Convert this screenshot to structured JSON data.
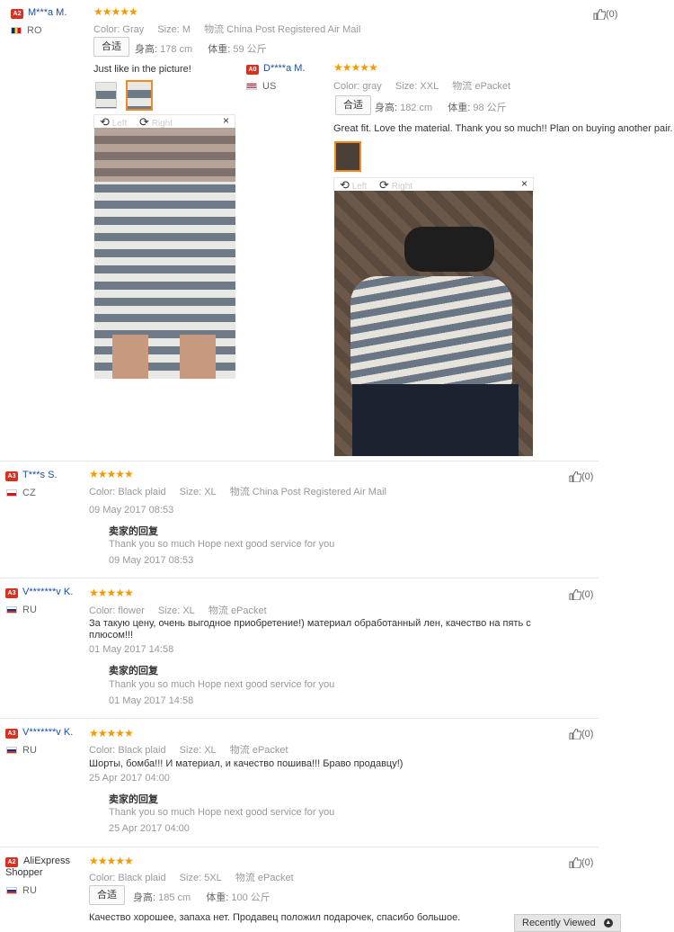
{
  "reviews": [
    {
      "badge": "A2",
      "user": "M***a M.",
      "country": "RO",
      "stars": "★★★★★",
      "color_label": "Color:",
      "color": "Gray",
      "size_label": "Size:",
      "size": "M",
      "ship_label": "物流",
      "ship": "China Post Registered Air Mail",
      "fit_chip": "合适",
      "height_label": "身高:",
      "height": "178 cm",
      "weight_label": "体重:",
      "weight": "59 公斤",
      "text": "Just like in the picture!",
      "likes": "(0)",
      "viewer": {
        "left": "Left",
        "right": "Right",
        "close": "×"
      }
    },
    {
      "badge": "A0",
      "user": "D****a M.",
      "country": "US",
      "stars": "★★★★★",
      "color_label": "Color:",
      "color": "gray",
      "size_label": "Size:",
      "size": "XXL",
      "ship_label": "物流",
      "ship": "ePacket",
      "fit_chip": "合适",
      "height_label": "身高:",
      "height": "182 cm",
      "weight_label": "体重:",
      "weight": "98 公斤",
      "text": "Great fit. Love the material. Thank you so much!! Plan on buying another pair.",
      "viewer": {
        "left": "Left",
        "right": "Right",
        "close": "×"
      }
    },
    {
      "badge": "A3",
      "user": "T***s S.",
      "country": "CZ",
      "stars": "★★★★★",
      "color_label": "Color:",
      "color": "Black plaid",
      "size_label": "Size:",
      "size": "XL",
      "ship_label": "物流",
      "ship": "China Post Registered Air Mail",
      "date": "09 May 2017 08:53",
      "reply_title": "卖家的回复",
      "reply_text": "Thank you so much Hope next good service for you",
      "reply_date": "09 May 2017 08:53",
      "likes": "(0)"
    },
    {
      "badge": "A3",
      "user": "V*******v K.",
      "country": "RU",
      "stars": "★★★★★",
      "color_label": "Color:",
      "color": "flower",
      "size_label": "Size:",
      "size": "XL",
      "ship_label": "物流",
      "ship": "ePacket",
      "text": "За такую цену, очень выгодное приобретение!) материал обработанный лен, качество на пять с плюсом!!!",
      "date": "01 May 2017 14:58",
      "reply_title": "卖家的回复",
      "reply_text": "Thank you so much Hope next good service for you",
      "reply_date": "01 May 2017 14:58",
      "likes": "(0)"
    },
    {
      "badge": "A3",
      "user": "V*******v K.",
      "country": "RU",
      "stars": "★★★★★",
      "color_label": "Color:",
      "color": "Black plaid",
      "size_label": "Size:",
      "size": "XL",
      "ship_label": "物流",
      "ship": "ePacket",
      "text": "Шорты, бомба!!! И материал, и качество пошива!!! Браво продавцу!)",
      "date": "25 Apr 2017 04:00",
      "reply_title": "卖家的回复",
      "reply_text": "Thank you so much Hope next good service for you",
      "reply_date": "25 Apr 2017 04:00",
      "likes": "(0)"
    },
    {
      "badge": "A2",
      "user": "AliExpress Shopper",
      "country": "RU",
      "stars": "★★★★★",
      "color_label": "Color:",
      "color": "Black plaid",
      "size_label": "Size:",
      "size": "5XL",
      "ship_label": "物流",
      "ship": "ePacket",
      "fit_chip": "合适",
      "height_label": "身高:",
      "height": "185 cm",
      "weight_label": "体重:",
      "weight": "100 公斤",
      "text": "Качество хорошее, запаха нет. Продавец положил подарочек, спасибо большое.",
      "likes": "(0)"
    }
  ],
  "recently_viewed": "Recently Viewed",
  "colors": {
    "accent_red": "#d9301f",
    "star": "#f59b00",
    "link": "#1a4fa0"
  }
}
